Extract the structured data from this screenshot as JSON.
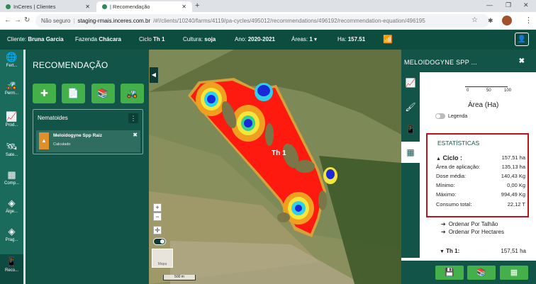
{
  "browser": {
    "tabs": [
      {
        "label": "InCeres | Clientes",
        "active": false
      },
      {
        "label": "| Recomendação",
        "active": true
      }
    ],
    "url_security": "Não seguro",
    "url_host": "staging-rmais.inceres.com.br",
    "url_path": "/#!/clients/10240/farms/4119/pa-cycles/495012/recommendations/496192/recommendation-equation/496195"
  },
  "appbar": {
    "client_label": "Cliente:",
    "client": "Bruna Garcia",
    "farm_label": "Fazenda",
    "farm": "Chácara",
    "cycle_label": "Ciclo",
    "cycle": "Th 1",
    "crop_label": "Cultura:",
    "crop": "soja",
    "year_label": "Ano:",
    "year": "2020-2021",
    "areas_label": "Áreas:",
    "areas": "1",
    "ha_label": "Ha:",
    "ha": "157.51"
  },
  "leftnav": [
    {
      "label": "Fert...",
      "icon": "fertilizer-icon"
    },
    {
      "label": "Perm...",
      "icon": "tractor-icon"
    },
    {
      "label": "Prod...",
      "icon": "chart-line-icon"
    },
    {
      "label": "Sate...",
      "icon": "satellite-icon"
    },
    {
      "label": "Comp...",
      "icon": "composition-icon"
    },
    {
      "label": "Álge...",
      "icon": "layers-icon"
    },
    {
      "label": "Prag...",
      "icon": "layers-icon"
    },
    {
      "label": "Reco...",
      "icon": "recommendation-icon"
    }
  ],
  "panel": {
    "title": "RECOMENDAÇÃO",
    "nematoides_header": "Nematoides",
    "item_name": "Meloidogyne Spp Raiz",
    "item_status": "Calculado"
  },
  "map": {
    "field_label": "Th 1",
    "scale_label": "500 m",
    "thumb_label": "Mapa"
  },
  "right_panel": {
    "title": "MELOIDOGYNE SPP ...",
    "ruler_ticks": [
      "0",
      "50",
      "100"
    ],
    "area_title": "Área (Ha)",
    "legend_label": "Legenda",
    "stats_title": "ESTATÍSTICAS",
    "stats": {
      "cycle_label": "Ciclo :",
      "cycle_value": "157,51 ha",
      "rows": [
        {
          "label": "Área de aplicação:",
          "value": "135,13 ha"
        },
        {
          "label": "Dose média:",
          "value": "140,43 Kg"
        },
        {
          "label": "Mínimo:",
          "value": "0,00 Kg"
        },
        {
          "label": "Máximo:",
          "value": "994,49 Kg"
        },
        {
          "label": "Consumo total:",
          "value": "22,12 T"
        }
      ]
    },
    "sort_by_plot": "Ordenar Por Talhão",
    "sort_by_hectares": "Ordenar Por Hectares",
    "th1_label": "Th 1:",
    "th1_value": "157,51 ha"
  }
}
